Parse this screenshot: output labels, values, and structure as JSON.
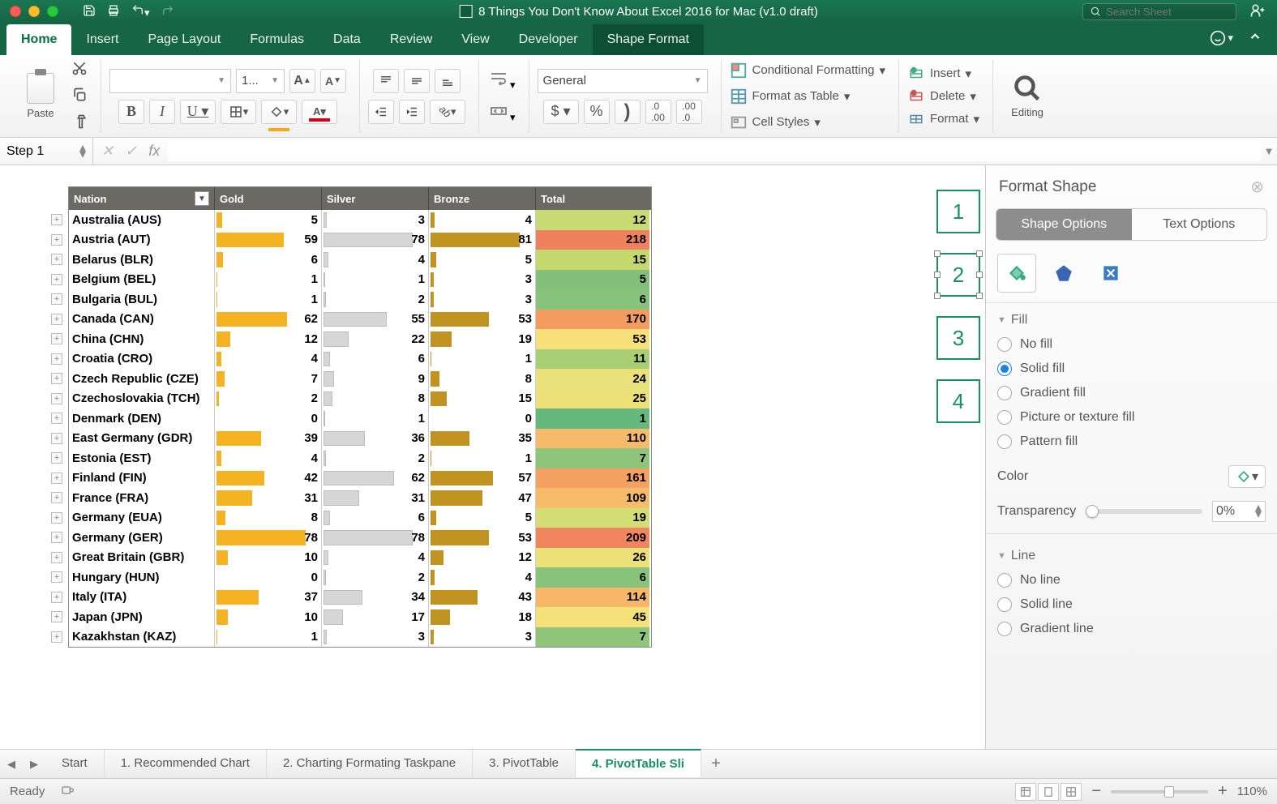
{
  "window": {
    "title": "8 Things You Don't Know About Excel 2016 for Mac (v1.0 draft)"
  },
  "search": {
    "placeholder": "Search Sheet"
  },
  "ribbon": {
    "tabs": [
      "Home",
      "Insert",
      "Page Layout",
      "Formulas",
      "Data",
      "Review",
      "View",
      "Developer",
      "Shape Format"
    ],
    "active": "Home",
    "highlighted": "Shape Format",
    "paste": "Paste",
    "editing": "Editing",
    "font_name": "",
    "font_size": "1...",
    "number_format": "General",
    "cond_fmt": "Conditional Formatting",
    "fmt_table": "Format as Table",
    "cell_styles": "Cell Styles",
    "insert": "Insert",
    "delete": "Delete",
    "format": "Format"
  },
  "formula": {
    "name": "Step 1",
    "fx": "fx"
  },
  "table": {
    "headers": {
      "nation": "Nation",
      "gold": "Gold",
      "silver": "Silver",
      "bronze": "Bronze",
      "total": "Total"
    },
    "max": {
      "gold": 78,
      "silver": 78,
      "bronze": 81
    },
    "rows": [
      {
        "nation": "Australia (AUS)",
        "gold": 5,
        "silver": 3,
        "bronze": 4,
        "total": 12,
        "tcol": "#c7da74"
      },
      {
        "nation": "Austria (AUT)",
        "gold": 59,
        "silver": 78,
        "bronze": 81,
        "total": 218,
        "tcol": "#f0815f"
      },
      {
        "nation": "Belarus (BLR)",
        "gold": 6,
        "silver": 4,
        "bronze": 5,
        "total": 15,
        "tcol": "#c5d86e"
      },
      {
        "nation": "Belgium (BEL)",
        "gold": 1,
        "silver": 1,
        "bronze": 3,
        "total": 5,
        "tcol": "#82c07b"
      },
      {
        "nation": "Bulgaria (BUL)",
        "gold": 1,
        "silver": 2,
        "bronze": 3,
        "total": 6,
        "tcol": "#88c37b"
      },
      {
        "nation": "Canada (CAN)",
        "gold": 62,
        "silver": 55,
        "bronze": 53,
        "total": 170,
        "tcol": "#f49b5f"
      },
      {
        "nation": "China (CHN)",
        "gold": 12,
        "silver": 22,
        "bronze": 19,
        "total": 53,
        "tcol": "#f7e079"
      },
      {
        "nation": "Croatia (CRO)",
        "gold": 4,
        "silver": 6,
        "bronze": 1,
        "total": 11,
        "tcol": "#a9cf75"
      },
      {
        "nation": "Czech Republic (CZE)",
        "gold": 7,
        "silver": 9,
        "bronze": 8,
        "total": 24,
        "tcol": "#e9e179"
      },
      {
        "nation": "Czechoslovakia (TCH)",
        "gold": 2,
        "silver": 8,
        "bronze": 15,
        "total": 25,
        "tcol": "#ece179"
      },
      {
        "nation": "Denmark (DEN)",
        "gold": 0,
        "silver": 1,
        "bronze": 0,
        "total": 1,
        "tcol": "#65b97c"
      },
      {
        "nation": "East Germany (GDR)",
        "gold": 39,
        "silver": 36,
        "bronze": 35,
        "total": 110,
        "tcol": "#f6bb6a"
      },
      {
        "nation": "Estonia (EST)",
        "gold": 4,
        "silver": 2,
        "bronze": 1,
        "total": 7,
        "tcol": "#8ec57b"
      },
      {
        "nation": "Finland (FIN)",
        "gold": 42,
        "silver": 62,
        "bronze": 57,
        "total": 161,
        "tcol": "#f4a161"
      },
      {
        "nation": "France (FRA)",
        "gold": 31,
        "silver": 31,
        "bronze": 47,
        "total": 109,
        "tcol": "#f6bc6a"
      },
      {
        "nation": "Germany (EUA)",
        "gold": 8,
        "silver": 6,
        "bronze": 5,
        "total": 19,
        "tcol": "#d3dd75"
      },
      {
        "nation": "Germany (GER)",
        "gold": 78,
        "silver": 78,
        "bronze": 53,
        "total": 209,
        "tcol": "#f18560"
      },
      {
        "nation": "Great Britain (GBR)",
        "gold": 10,
        "silver": 4,
        "bronze": 12,
        "total": 26,
        "tcol": "#ece179"
      },
      {
        "nation": "Hungary (HUN)",
        "gold": 0,
        "silver": 2,
        "bronze": 4,
        "total": 6,
        "tcol": "#88c37b"
      },
      {
        "nation": "Italy (ITA)",
        "gold": 37,
        "silver": 34,
        "bronze": 43,
        "total": 114,
        "tcol": "#f6b868"
      },
      {
        "nation": "Japan (JPN)",
        "gold": 10,
        "silver": 17,
        "bronze": 18,
        "total": 45,
        "tcol": "#f5e179"
      },
      {
        "nation": "Kazakhstan (KAZ)",
        "gold": 1,
        "silver": 3,
        "bronze": 3,
        "total": 7,
        "tcol": "#8ec57b"
      }
    ]
  },
  "slicers": [
    1,
    2,
    3,
    4
  ],
  "pane": {
    "title": "Format Shape",
    "tabs": {
      "shape": "Shape Options",
      "text": "Text Options"
    },
    "fill": {
      "title": "Fill",
      "opts": [
        "No fill",
        "Solid fill",
        "Gradient fill",
        "Picture or texture fill",
        "Pattern fill"
      ],
      "selected": "Solid fill",
      "color": "Color",
      "transparency": "Transparency",
      "tval": "0%"
    },
    "line": {
      "title": "Line",
      "opts": [
        "No line",
        "Solid line",
        "Gradient line"
      ]
    }
  },
  "sheets": {
    "tabs": [
      "Start",
      "1. Recommended Chart",
      "2. Charting Formating Taskpane",
      "3. PivotTable",
      "4. PivotTable Sli"
    ],
    "active": 4
  },
  "status": {
    "ready": "Ready",
    "zoom": "110%"
  }
}
